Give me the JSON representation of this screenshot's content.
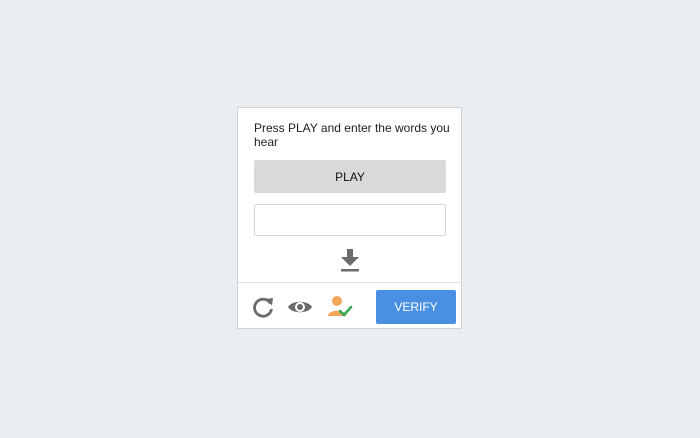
{
  "captcha": {
    "instructions": "Press PLAY and enter the words you hear",
    "play_label": "PLAY",
    "answer_value": "",
    "answer_placeholder": "",
    "download_icon": "download-icon",
    "footer": {
      "reload_icon": "reload-icon",
      "visual_challenge_icon": "eye-icon",
      "user_check_icon": "user-check-icon",
      "verify_label": "VERIFY"
    }
  },
  "colors": {
    "page_background": "#ebeef0",
    "card_background": "#ffffff",
    "play_button": "#d9d9d9",
    "verify_button": "#4a90e2",
    "icon_gray": "#6b6b6b",
    "user_orange": "#f2a65a",
    "check_green": "#34a853"
  }
}
